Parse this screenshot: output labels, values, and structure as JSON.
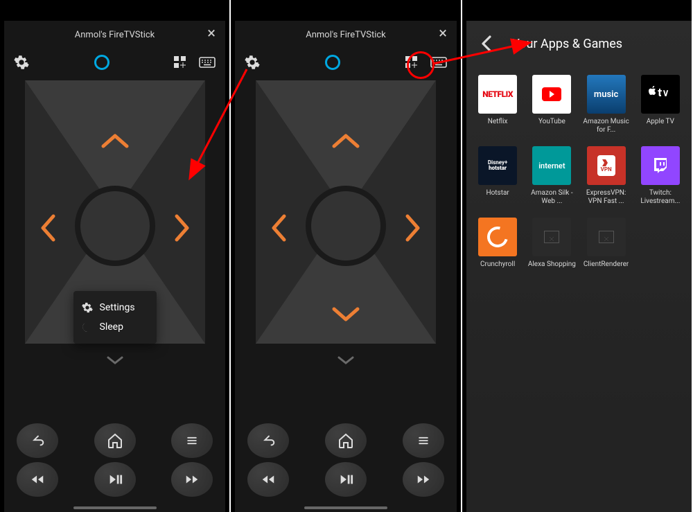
{
  "device_title": "Anmol's FireTVStick",
  "popup": {
    "settings": "Settings",
    "sleep": "Sleep"
  },
  "apps": {
    "header": "Your Apps & Games",
    "items": [
      {
        "label": "Netflix"
      },
      {
        "label": "YouTube"
      },
      {
        "label": "Amazon Music for F..."
      },
      {
        "label": "Apple TV"
      },
      {
        "label": "Hotstar"
      },
      {
        "label": "Amazon Silk - Web ..."
      },
      {
        "label": "ExpressVPN: VPN Fast ..."
      },
      {
        "label": "Twitch: Livestream..."
      },
      {
        "label": "Crunchyroll"
      },
      {
        "label": "Alexa Shopping"
      },
      {
        "label": "ClientRenderer"
      }
    ]
  },
  "icons": {
    "vpn": "VPN"
  },
  "colors": {
    "accent_dpad": "#ed7f34",
    "alexa_ring": "#00a8e1",
    "annotation_red": "#ff0000"
  }
}
